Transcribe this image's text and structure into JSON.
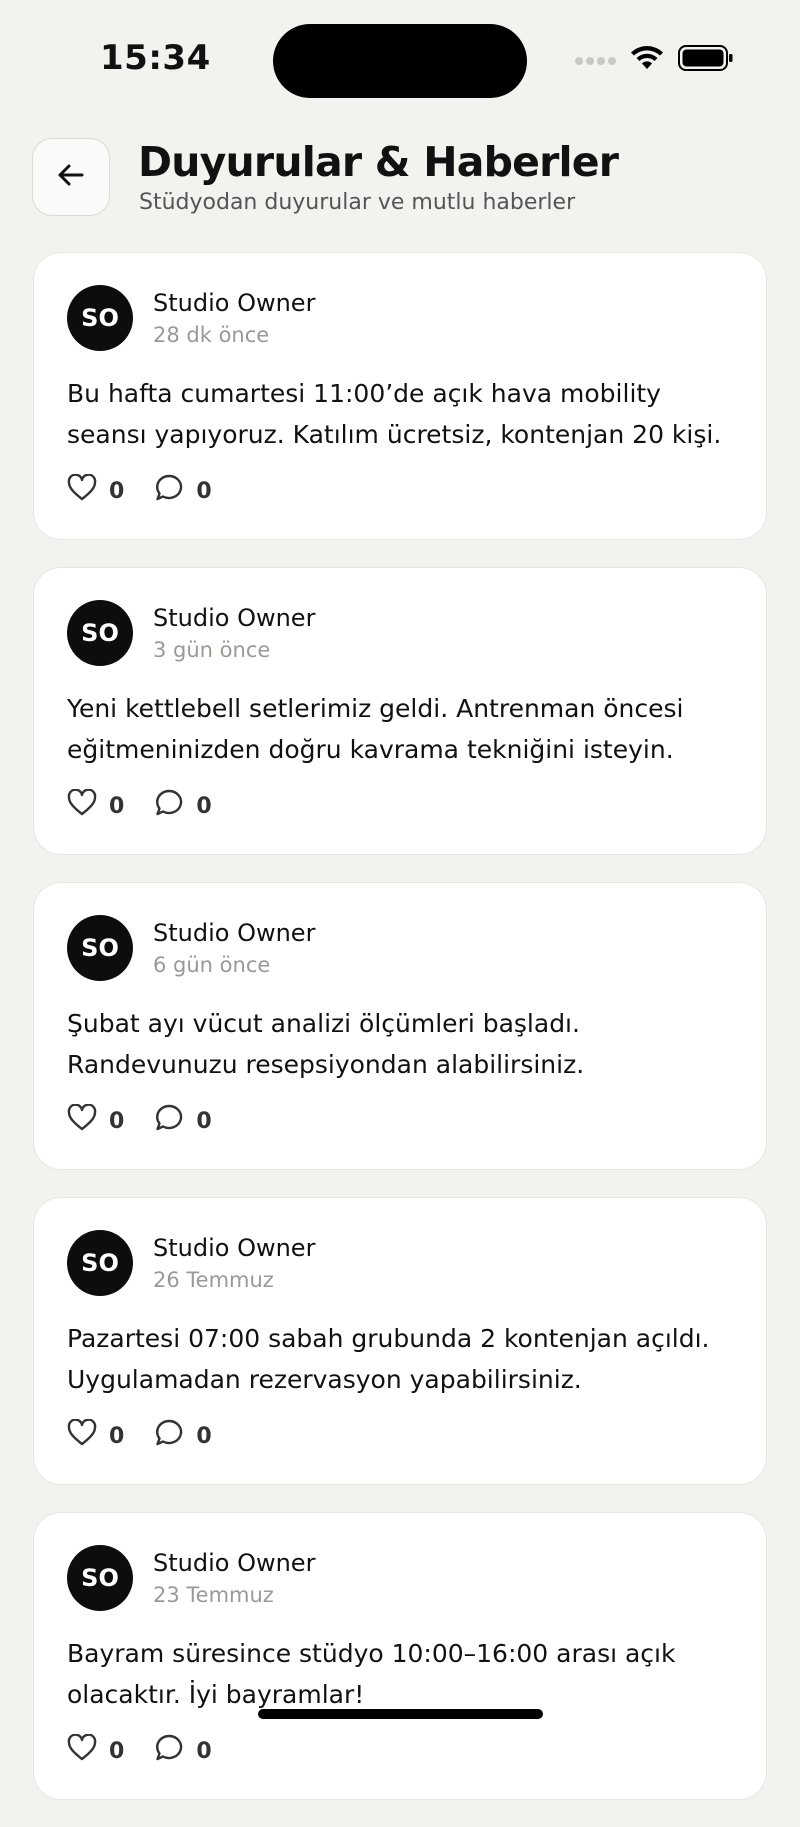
{
  "status_bar": {
    "time": "15:34"
  },
  "header": {
    "title": "Duyurular & Haberler",
    "subtitle": "Stüdyodan duyurular ve mutlu haberler"
  },
  "posts": [
    {
      "avatar_initials": "SO",
      "author": "Studio Owner",
      "time": "28 dk önce",
      "body": "Bu hafta cumartesi 11:00’de açık hava mobility seansı yapıyoruz. Katılım ücretsiz, kontenjan 20 kişi.",
      "likes": "0",
      "comments": "0"
    },
    {
      "avatar_initials": "SO",
      "author": "Studio Owner",
      "time": "3 gün önce",
      "body": "Yeni kettlebell setlerimiz geldi. Antrenman öncesi eğitmeninizden doğru kavrama tekniğini isteyin.",
      "likes": "0",
      "comments": "0"
    },
    {
      "avatar_initials": "SO",
      "author": "Studio Owner",
      "time": "6 gün önce",
      "body": "Şubat ayı vücut analizi ölçümleri başladı. Randevunuzu resepsiyondan alabilirsiniz.",
      "likes": "0",
      "comments": "0"
    },
    {
      "avatar_initials": "SO",
      "author": "Studio Owner",
      "time": "26 Temmuz",
      "body": "Pazartesi 07:00 sabah grubunda 2 kontenjan açıldı. Uygulamadan rezervasyon yapabilirsiniz.",
      "likes": "0",
      "comments": "0"
    },
    {
      "avatar_initials": "SO",
      "author": "Studio Owner",
      "time": "23 Temmuz",
      "body": "Bayram süresince stüdyo 10:00–16:00 arası açık olacaktır. İyi bayramlar!",
      "likes": "0",
      "comments": "0"
    }
  ],
  "icons": {
    "back": "arrow-left-icon",
    "like": "heart-icon",
    "comment": "comment-bubble-icon",
    "signal": "signal-dots-icon",
    "wifi": "wifi-icon",
    "battery": "battery-icon"
  },
  "colors": {
    "background": "#f2f2ef",
    "card": "#ffffff",
    "avatar": "#0d0d0d",
    "muted_text": "#9a9a95"
  }
}
